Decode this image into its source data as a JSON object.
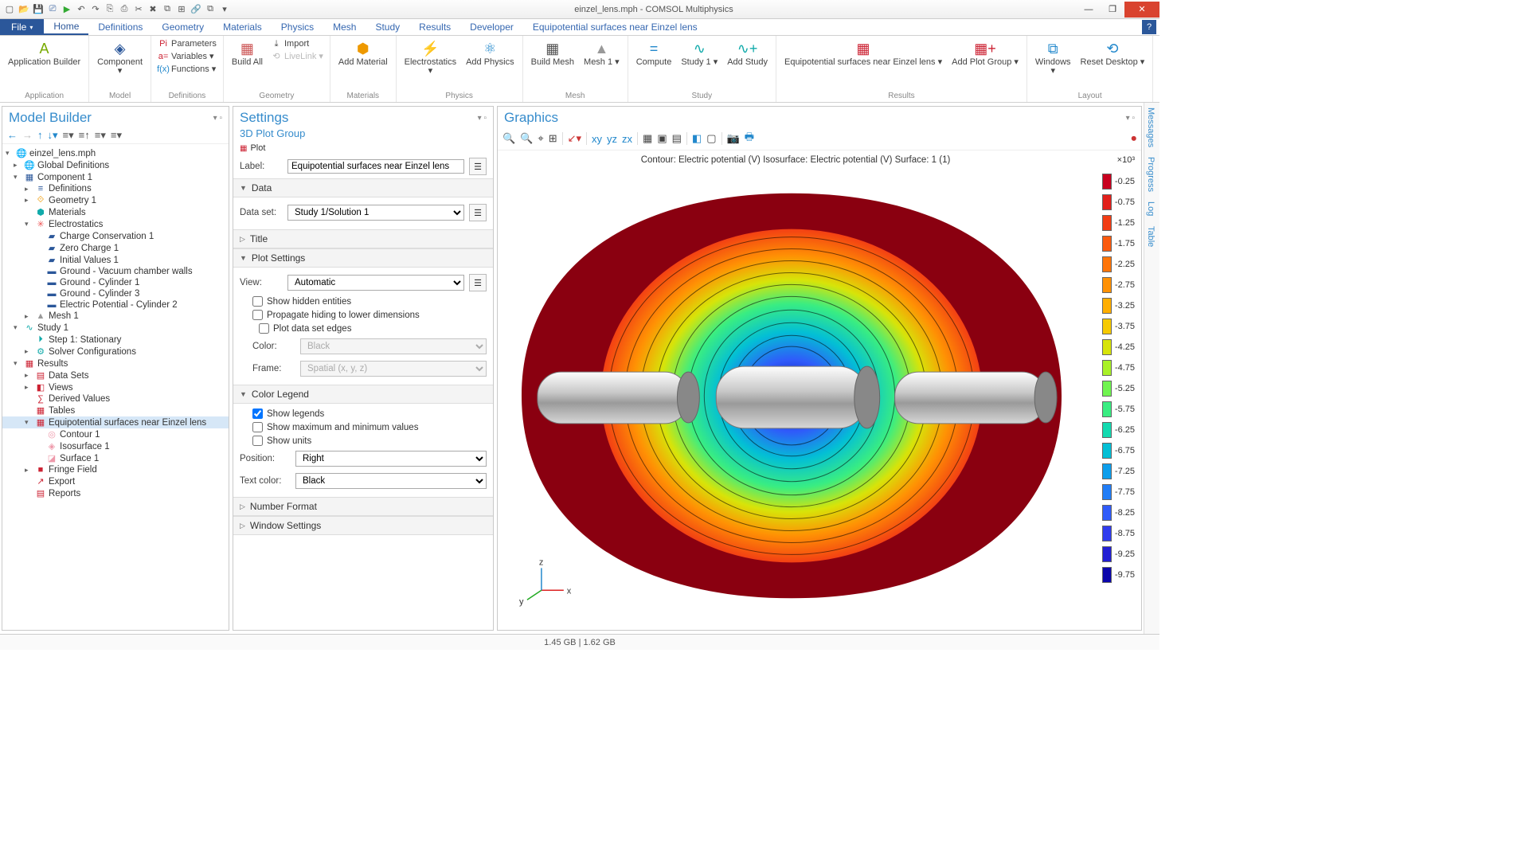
{
  "window_title": "einzel_lens.mph - COMSOL Multiphysics",
  "file_button": "File",
  "tabs": [
    "Home",
    "Definitions",
    "Geometry",
    "Materials",
    "Physics",
    "Mesh",
    "Study",
    "Results",
    "Developer",
    "Equipotential surfaces near Einzel lens"
  ],
  "ribbon": {
    "app_builder": "Application\nBuilder",
    "application_group": "Application",
    "component": "Component",
    "model_group": "Model",
    "parameters": "Parameters",
    "variables": "Variables",
    "functions": "Functions",
    "definitions_group": "Definitions",
    "import": "Import",
    "livelink": "LiveLink",
    "build_all": "Build\nAll",
    "geometry_group": "Geometry",
    "add_material": "Add\nMaterial",
    "materials_group": "Materials",
    "electrostatics": "Electrostatics",
    "add_physics": "Add\nPhysics",
    "physics_group": "Physics",
    "build_mesh": "Build\nMesh",
    "mesh1": "Mesh\n1",
    "mesh_group": "Mesh",
    "compute": "Compute",
    "study1": "Study\n1",
    "add_study": "Add\nStudy",
    "study_group": "Study",
    "equi_near": "Equipotential surfaces\nnear Einzel lens",
    "add_plot_group": "Add Plot\nGroup",
    "results_group": "Results",
    "windows": "Windows",
    "reset_desktop": "Reset\nDesktop",
    "layout_group": "Layout"
  },
  "model_builder": {
    "title": "Model Builder",
    "tree": [
      {
        "lvl": 0,
        "arrow": "▾",
        "icon": "🌐",
        "label": "einzel_lens.mph"
      },
      {
        "lvl": 1,
        "arrow": "▸",
        "icon": "🌐",
        "label": "Global Definitions",
        "c": "#7a7"
      },
      {
        "lvl": 1,
        "arrow": "▾",
        "icon": "▦",
        "label": "Component 1",
        "c": "#2b579a"
      },
      {
        "lvl": 2,
        "arrow": "▸",
        "icon": "≡",
        "label": "Definitions",
        "c": "#2b579a"
      },
      {
        "lvl": 2,
        "arrow": "▸",
        "icon": "⟐",
        "label": "Geometry 1",
        "c": "#e90"
      },
      {
        "lvl": 2,
        "arrow": "",
        "icon": "⬢",
        "label": "Materials",
        "c": "#1aa"
      },
      {
        "lvl": 2,
        "arrow": "▾",
        "icon": "✳",
        "label": "Electrostatics",
        "c": "#e55"
      },
      {
        "lvl": 3,
        "arrow": "",
        "icon": "▰",
        "label": "Charge Conservation 1",
        "c": "#2b579a"
      },
      {
        "lvl": 3,
        "arrow": "",
        "icon": "▰",
        "label": "Zero Charge 1",
        "c": "#2b579a"
      },
      {
        "lvl": 3,
        "arrow": "",
        "icon": "▰",
        "label": "Initial Values 1",
        "c": "#2b579a"
      },
      {
        "lvl": 3,
        "arrow": "",
        "icon": "▬",
        "label": "Ground - Vacuum chamber walls",
        "c": "#2b579a"
      },
      {
        "lvl": 3,
        "arrow": "",
        "icon": "▬",
        "label": "Ground - Cylinder 1",
        "c": "#2b579a"
      },
      {
        "lvl": 3,
        "arrow": "",
        "icon": "▬",
        "label": "Ground - Cylinder 3",
        "c": "#2b579a"
      },
      {
        "lvl": 3,
        "arrow": "",
        "icon": "▬",
        "label": "Electric Potential - Cylinder 2",
        "c": "#2b579a"
      },
      {
        "lvl": 2,
        "arrow": "▸",
        "icon": "▲",
        "label": "Mesh 1",
        "c": "#999"
      },
      {
        "lvl": 1,
        "arrow": "▾",
        "icon": "∿",
        "label": "Study 1",
        "c": "#1aa"
      },
      {
        "lvl": 2,
        "arrow": "",
        "icon": "⏵",
        "label": "Step 1: Stationary",
        "c": "#1aa"
      },
      {
        "lvl": 2,
        "arrow": "▸",
        "icon": "⚙",
        "label": "Solver Configurations",
        "c": "#1aa"
      },
      {
        "lvl": 1,
        "arrow": "▾",
        "icon": "▦",
        "label": "Results",
        "c": "#c23"
      },
      {
        "lvl": 2,
        "arrow": "▸",
        "icon": "▤",
        "label": "Data Sets",
        "c": "#c23"
      },
      {
        "lvl": 2,
        "arrow": "▸",
        "icon": "◧",
        "label": "Views",
        "c": "#c23"
      },
      {
        "lvl": 2,
        "arrow": "",
        "icon": "∑",
        "label": "Derived Values",
        "c": "#c23"
      },
      {
        "lvl": 2,
        "arrow": "",
        "icon": "▦",
        "label": "Tables",
        "c": "#c23"
      },
      {
        "lvl": 2,
        "arrow": "▾",
        "icon": "▦",
        "label": "Equipotential surfaces near Einzel lens",
        "c": "#c23",
        "sel": true
      },
      {
        "lvl": 3,
        "arrow": "",
        "icon": "◎",
        "label": "Contour 1",
        "c": "#e9a"
      },
      {
        "lvl": 3,
        "arrow": "",
        "icon": "◈",
        "label": "Isosurface 1",
        "c": "#e9a"
      },
      {
        "lvl": 3,
        "arrow": "",
        "icon": "◪",
        "label": "Surface 1",
        "c": "#e9a"
      },
      {
        "lvl": 2,
        "arrow": "▸",
        "icon": "■",
        "label": "Fringe Field",
        "c": "#c23"
      },
      {
        "lvl": 2,
        "arrow": "",
        "icon": "↗",
        "label": "Export",
        "c": "#c23"
      },
      {
        "lvl": 2,
        "arrow": "",
        "icon": "▤",
        "label": "Reports",
        "c": "#c23"
      }
    ]
  },
  "settings": {
    "title": "Settings",
    "subtitle": "3D Plot Group",
    "plot_label": "Plot",
    "label_lbl": "Label:",
    "label_val": "Equipotential surfaces near Einzel lens",
    "data_sect": "Data",
    "dataset_lbl": "Data set:",
    "dataset_val": "Study 1/Solution 1",
    "title_sect": "Title",
    "plotsettings_sect": "Plot Settings",
    "view_lbl": "View:",
    "view_val": "Automatic",
    "show_hidden": "Show hidden entities",
    "propagate": "Propagate hiding to lower dimensions",
    "plot_edges": "Plot data set edges",
    "color_lbl": "Color:",
    "color_val": "Black",
    "frame_lbl": "Frame:",
    "frame_val": "Spatial  (x, y, z)",
    "colorlegend_sect": "Color Legend",
    "show_legends": "Show legends",
    "show_minmax": "Show maximum and minimum values",
    "show_units": "Show units",
    "position_lbl": "Position:",
    "position_val": "Right",
    "textcolor_lbl": "Text color:",
    "textcolor_val": "Black",
    "numfmt_sect": "Number Format",
    "winset_sect": "Window Settings"
  },
  "graphics": {
    "title": "Graphics",
    "plot_title": "Contour: Electric potential (V)   Isosurface: Electric potential (V)   Surface: 1 (1)",
    "exponent": "×10³",
    "colorbar": [
      {
        "c": "#c8001e",
        "v": "-0.25"
      },
      {
        "c": "#e21f1a",
        "v": "-0.75"
      },
      {
        "c": "#f23c14",
        "v": "-1.25"
      },
      {
        "c": "#fb5a0e",
        "v": "-1.75"
      },
      {
        "c": "#ff7508",
        "v": "-2.25"
      },
      {
        "c": "#ff9104",
        "v": "-2.75"
      },
      {
        "c": "#ffae00",
        "v": "-3.25"
      },
      {
        "c": "#f6ca00",
        "v": "-3.75"
      },
      {
        "c": "#d7e409",
        "v": "-4.25"
      },
      {
        "c": "#a9f127",
        "v": "-4.75"
      },
      {
        "c": "#70f550",
        "v": "-5.25"
      },
      {
        "c": "#39ed82",
        "v": "-5.75"
      },
      {
        "c": "#12dab0",
        "v": "-6.25"
      },
      {
        "c": "#03bfd5",
        "v": "-6.75"
      },
      {
        "c": "#0c9eec",
        "v": "-7.25"
      },
      {
        "c": "#207df7",
        "v": "-7.75"
      },
      {
        "c": "#2f5bfa",
        "v": "-8.25"
      },
      {
        "c": "#2f3bee",
        "v": "-8.75"
      },
      {
        "c": "#221ed4",
        "v": "-9.25"
      },
      {
        "c": "#0b05ab",
        "v": "-9.75"
      }
    ]
  },
  "sidetabs": [
    "Messages",
    "Progress",
    "Log",
    "Table"
  ],
  "status": "1.45 GB | 1.62 GB"
}
